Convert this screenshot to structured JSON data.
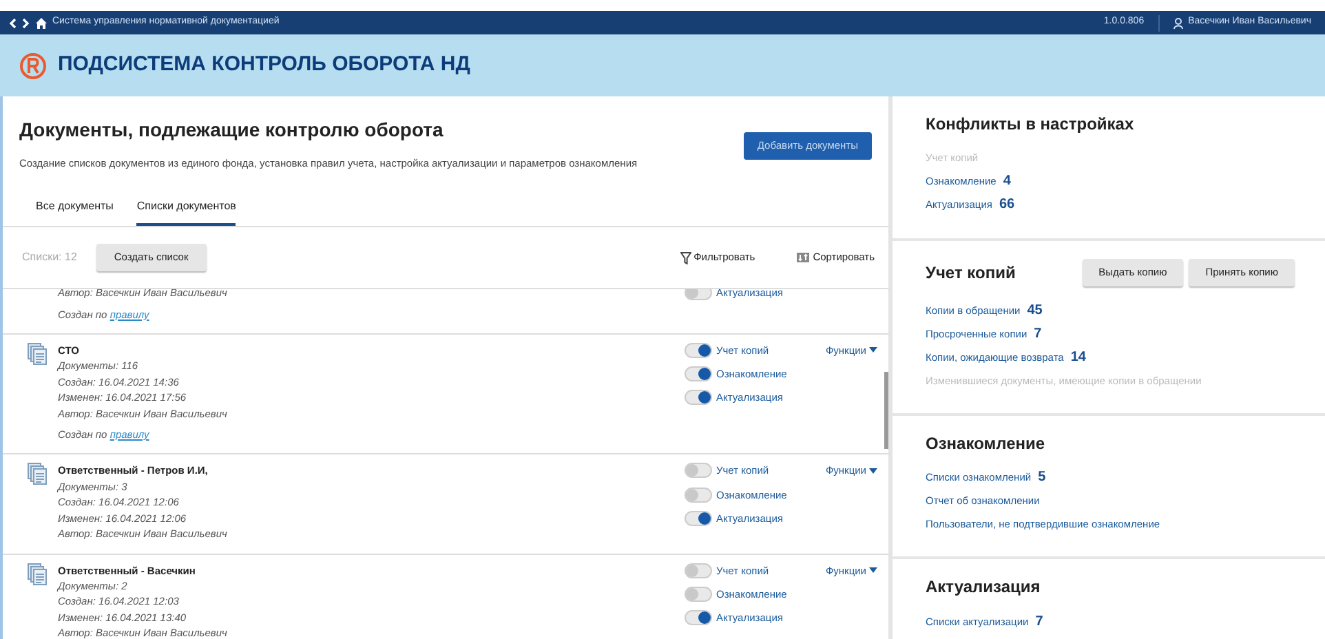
{
  "topbar": {
    "app_title": "Система управления нормативной документацией",
    "version": "1.0.0.806",
    "user": "Васечкин Иван Васильевич"
  },
  "header": {
    "title": "ПОДСИСТЕМА КОНТРОЛЬ ОБОРОТА НД"
  },
  "page": {
    "title": "Документы, подлежащие контролю оборота",
    "subtitle": "Создание списков документов из единого фонда, установка правил учета, настройка актуализации и параметров ознакомления",
    "add_button": "Добавить документы"
  },
  "tabs": [
    {
      "label": "Все документы",
      "selected": false
    },
    {
      "label": "Списки документов",
      "selected": true
    }
  ],
  "toolbar": {
    "count": "Списки: 12",
    "create_button": "Создать список",
    "filter": "Фильтровать",
    "sort": "Сортировать"
  },
  "lists": [
    {
      "meta": [
        "Автор: Васечкин Иван Васильевич"
      ],
      "rule_prefix": "Создан по",
      "rule_link": "правилу",
      "toggles": [
        {
          "label": "Актуализация",
          "on": false
        }
      ]
    },
    {
      "title": "СТО",
      "meta": [
        "Документы: 116",
        "Создан: 16.04.2021 14:36",
        "Изменен: 16.04.2021 17:56",
        "Автор: Васечкин Иван Васильевич"
      ],
      "rule_prefix": "Создан по",
      "rule_link": "правилу",
      "functions": "Функции",
      "toggles": [
        {
          "label": "Учет копий",
          "on": true
        },
        {
          "label": "Ознакомление",
          "on": true
        },
        {
          "label": "Актуализация",
          "on": true
        }
      ]
    },
    {
      "title": "Ответственный - Петров И.И,",
      "meta": [
        "Документы: 3",
        "Создан: 16.04.2021 12:06",
        "Изменен: 16.04.2021 12:06",
        "Автор: Васечкин Иван Васильевич"
      ],
      "functions": "Функции",
      "toggles": [
        {
          "label": "Учет копий",
          "on": false
        },
        {
          "label": "Ознакомление",
          "on": false
        },
        {
          "label": "Актуализация",
          "on": true
        }
      ]
    },
    {
      "title": "Ответственный - Васечкин",
      "meta": [
        "Документы: 2",
        "Создан: 16.04.2021 12:03",
        "Изменен: 16.04.2021 13:40",
        "Автор: Васечкин Иван Васильевич"
      ],
      "functions": "Функции",
      "toggles": [
        {
          "label": "Учет копий",
          "on": false
        },
        {
          "label": "Ознакомление",
          "on": false
        },
        {
          "label": "Актуализация",
          "on": true
        }
      ]
    }
  ],
  "sections": [
    {
      "title": "Конфликты в настройках",
      "links": [
        {
          "label": "Учет копий",
          "disabled": true
        },
        {
          "label": "Ознакомление",
          "count": "4",
          "disabled": false
        },
        {
          "label": "Актуализация",
          "count": "66",
          "disabled": false
        }
      ]
    },
    {
      "title": "Учет копий",
      "buttons": [
        "Выдать копию",
        "Принять копию"
      ],
      "links": [
        {
          "label": "Копии в обращении",
          "count": "45",
          "disabled": false
        },
        {
          "label": "Просроченные копии",
          "count": "7",
          "disabled": false
        },
        {
          "label": "Копии, ожидающие возврата",
          "count": "14",
          "disabled": false
        },
        {
          "label": "Изменившиеся документы, имеющие копии в обращении",
          "disabled": true
        }
      ]
    },
    {
      "title": "Ознакомление",
      "links": [
        {
          "label": "Списки ознакомлений",
          "count": "5",
          "disabled": false
        },
        {
          "label": "Отчет об ознакомлении",
          "disabled": false
        },
        {
          "label": "Пользователи, не подтвердившие ознакомление",
          "disabled": false
        }
      ]
    },
    {
      "title": "Актуализация",
      "links": [
        {
          "label": "Списки актуализации",
          "count": "7",
          "disabled": false
        }
      ]
    }
  ]
}
